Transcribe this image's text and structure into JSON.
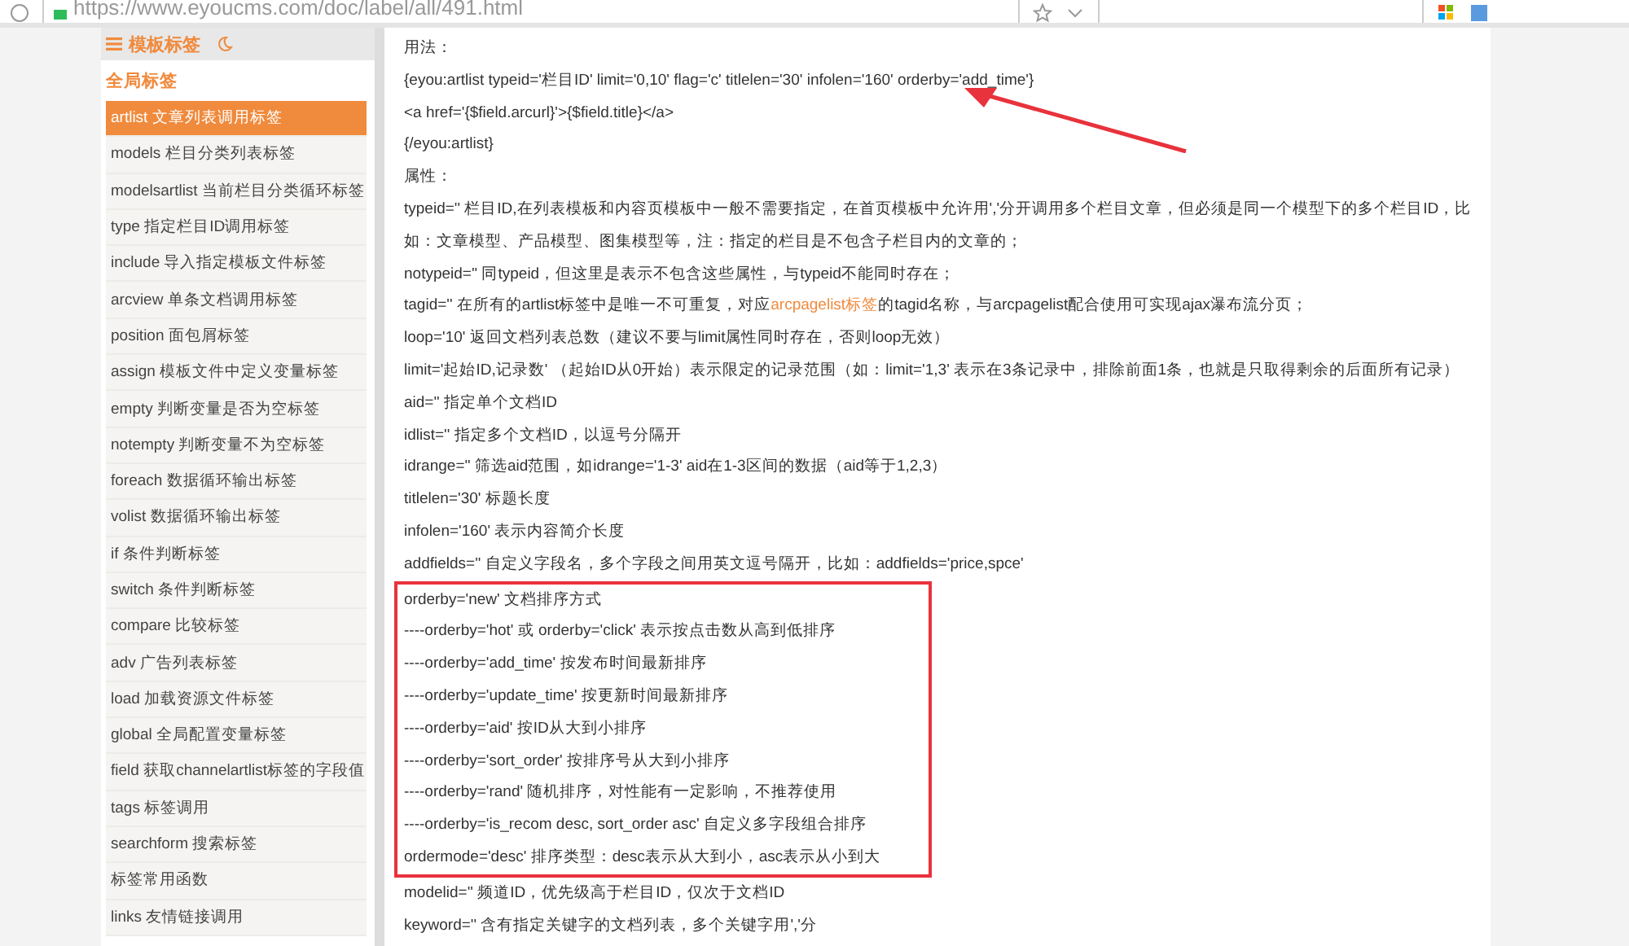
{
  "browser": {
    "url": "https://www.eyoucms.com/doc/label/all/491.html"
  },
  "sidebar": {
    "title": "模板标签",
    "section": "全局标签",
    "items": [
      {
        "label": "artlist 文章列表调用标签",
        "selected": true
      },
      {
        "label": "models 栏目分类列表标签",
        "selected": false
      },
      {
        "label": "modelsartlist 当前栏目分类循环标签",
        "selected": false
      },
      {
        "label": "type 指定栏目ID调用标签",
        "selected": false
      },
      {
        "label": "include 导入指定模板文件标签",
        "selected": false
      },
      {
        "label": "arcview 单条文档调用标签",
        "selected": false
      },
      {
        "label": "position 面包屑标签",
        "selected": false
      },
      {
        "label": "assign 模板文件中定义变量标签",
        "selected": false
      },
      {
        "label": "empty 判断变量是否为空标签",
        "selected": false
      },
      {
        "label": "notempty 判断变量不为空标签",
        "selected": false
      },
      {
        "label": "foreach 数据循环输出标签",
        "selected": false
      },
      {
        "label": "volist 数据循环输出标签",
        "selected": false
      },
      {
        "label": "if 条件判断标签",
        "selected": false
      },
      {
        "label": "switch 条件判断标签",
        "selected": false
      },
      {
        "label": "compare 比较标签",
        "selected": false
      },
      {
        "label": "adv 广告列表标签",
        "selected": false
      },
      {
        "label": "load 加载资源文件标签",
        "selected": false
      },
      {
        "label": "global 全局配置变量标签",
        "selected": false
      },
      {
        "label": "field 获取channelartlist标签的字段值",
        "selected": false
      },
      {
        "label": "tags 标签调用",
        "selected": false
      },
      {
        "label": "searchform 搜索标签",
        "selected": false
      },
      {
        "label": "标签常用函数",
        "selected": false
      },
      {
        "label": "links 友情链接调用",
        "selected": false
      }
    ]
  },
  "content": {
    "lines_before": [
      {
        "kind": "text",
        "text": "用法："
      },
      {
        "kind": "text",
        "text": "{eyou:artlist typeid='栏目ID' limit='0,10' flag='c' titlelen='30' infolen='160' orderby='add_time'}"
      },
      {
        "kind": "text",
        "text": "<a href='{$field.arcurl}'>{$field.title}</a>"
      },
      {
        "kind": "text",
        "text": "{/eyou:artlist}"
      },
      {
        "kind": "text",
        "text": "属性："
      },
      {
        "kind": "text",
        "text": "typeid='' 栏目ID,在列表模板和内容页模板中一般不需要指定，在首页模板中允许用','分开调用多个栏目文章，但必须是同一个模型下的多个栏目ID，比如：文章模型、产品模型、图集模型等，注：指定的栏目是不包含子栏目内的文章的；"
      },
      {
        "kind": "text",
        "text": "notypeid='' 同typeid，但这里是表示不包含这些属性，与typeid不能同时存在；"
      },
      {
        "kind": "link",
        "before": "tagid='' 在所有的artlist标签中是唯一不可重复，对应",
        "link": "arcpagelist标签",
        "after": "的tagid名称，与arcpagelist配合使用可实现ajax瀑布流分页；"
      },
      {
        "kind": "text",
        "text": "loop='10' 返回文档列表总数（建议不要与limit属性同时存在，否则loop无效）"
      },
      {
        "kind": "text",
        "text": "limit='起始ID,记录数' （起始ID从0开始）表示限定的记录范围（如：limit='1,3' 表示在3条记录中，排除前面1条，也就是只取得剩余的后面所有记录）"
      },
      {
        "kind": "text",
        "text": "aid='' 指定单个文档ID"
      },
      {
        "kind": "text",
        "text": "idlist='' 指定多个文档ID，以逗号分隔开"
      },
      {
        "kind": "text",
        "text": "idrange='' 筛选aid范围，如idrange='1-3'  aid在1-3区间的数据（aid等于1,2,3）"
      },
      {
        "kind": "text",
        "text": "titlelen='30' 标题长度"
      },
      {
        "kind": "text",
        "text": "infolen='160' 表示内容简介长度"
      },
      {
        "kind": "text",
        "text": "addfields='' 自定义字段名，多个字段之间用英文逗号隔开，比如：addfields='price,spce'"
      }
    ],
    "highlighted_lines": [
      "orderby='new' 文档排序方式",
      "----orderby='hot' 或 orderby='click' 表示按点击数从高到低排序",
      "----orderby='add_time' 按发布时间最新排序",
      "----orderby='update_time' 按更新时间最新排序",
      "----orderby='aid' 按ID从大到小排序",
      "----orderby='sort_order' 按排序号从大到小排序",
      "----orderby='rand' 随机排序，对性能有一定影响，不推荐使用",
      "----orderby='is_recom desc, sort_order asc' 自定义多字段组合排序",
      "ordermode='desc' 排序类型：desc表示从大到小，asc表示从小到大"
    ],
    "lines_after": [
      {
        "kind": "text",
        "text": "modelid='' 频道ID，优先级高于栏目ID，仅次于文档ID"
      },
      {
        "kind": "text",
        "text": "keyword='' 含有指定关键字的文档列表，多个关键字用','分"
      }
    ]
  }
}
